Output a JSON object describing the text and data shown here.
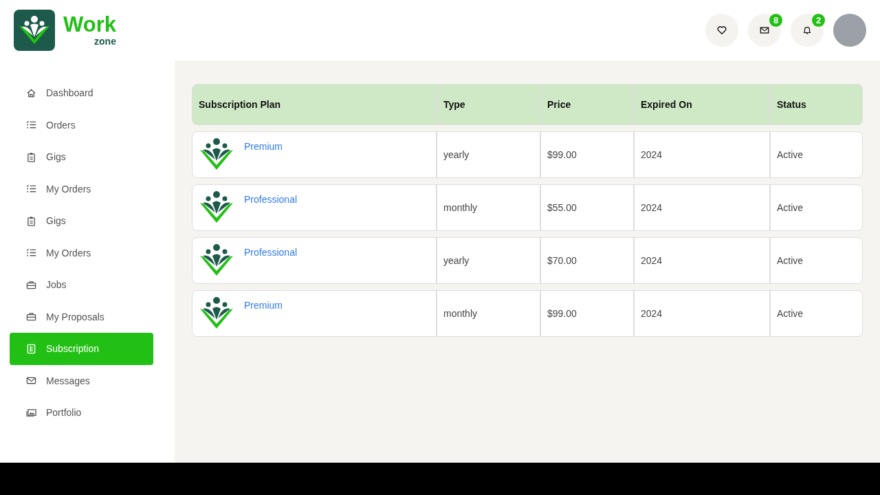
{
  "logo": {
    "title": "Work",
    "subtitle": "zone"
  },
  "header": {
    "actions": [
      {
        "kind": "heart"
      },
      {
        "kind": "mail",
        "badge": "8"
      },
      {
        "kind": "bell",
        "badge": "2"
      }
    ]
  },
  "sidebar": {
    "items": [
      {
        "label": "Dashboard",
        "kind": "home",
        "selected": false
      },
      {
        "label": "Orders",
        "kind": "list",
        "selected": false
      },
      {
        "label": "Gigs",
        "kind": "clipboard",
        "selected": false
      },
      {
        "label": "My Orders",
        "kind": "list",
        "selected": false
      },
      {
        "label": "Gigs",
        "kind": "clipboard",
        "selected": false
      },
      {
        "label": "My Orders",
        "kind": "list",
        "selected": false
      },
      {
        "label": "Jobs",
        "kind": "briefcase",
        "selected": false
      },
      {
        "label": "My Proposals",
        "kind": "briefcase",
        "selected": false
      },
      {
        "label": "Subscription",
        "kind": "sheet",
        "selected": true
      },
      {
        "label": "Messages",
        "kind": "mail",
        "selected": false
      },
      {
        "label": "Portfolio",
        "kind": "image",
        "selected": false
      }
    ]
  },
  "table": {
    "columns": [
      "Subscription Plan",
      "Type",
      "Price",
      "Expired On",
      "Status"
    ],
    "rows": [
      {
        "plan": "Premium",
        "type": "yearly",
        "price": "$99.00",
        "expired_on": "2024",
        "status": "Active"
      },
      {
        "plan": "Professional",
        "type": "monthly",
        "price": "$55.00",
        "expired_on": "2024",
        "status": "Active"
      },
      {
        "plan": "Professional",
        "type": "yearly",
        "price": "$70.00",
        "expired_on": "2024",
        "status": "Active"
      },
      {
        "plan": "Premium",
        "type": "monthly",
        "price": "$99.00",
        "expired_on": "2024",
        "status": "Active"
      }
    ]
  }
}
